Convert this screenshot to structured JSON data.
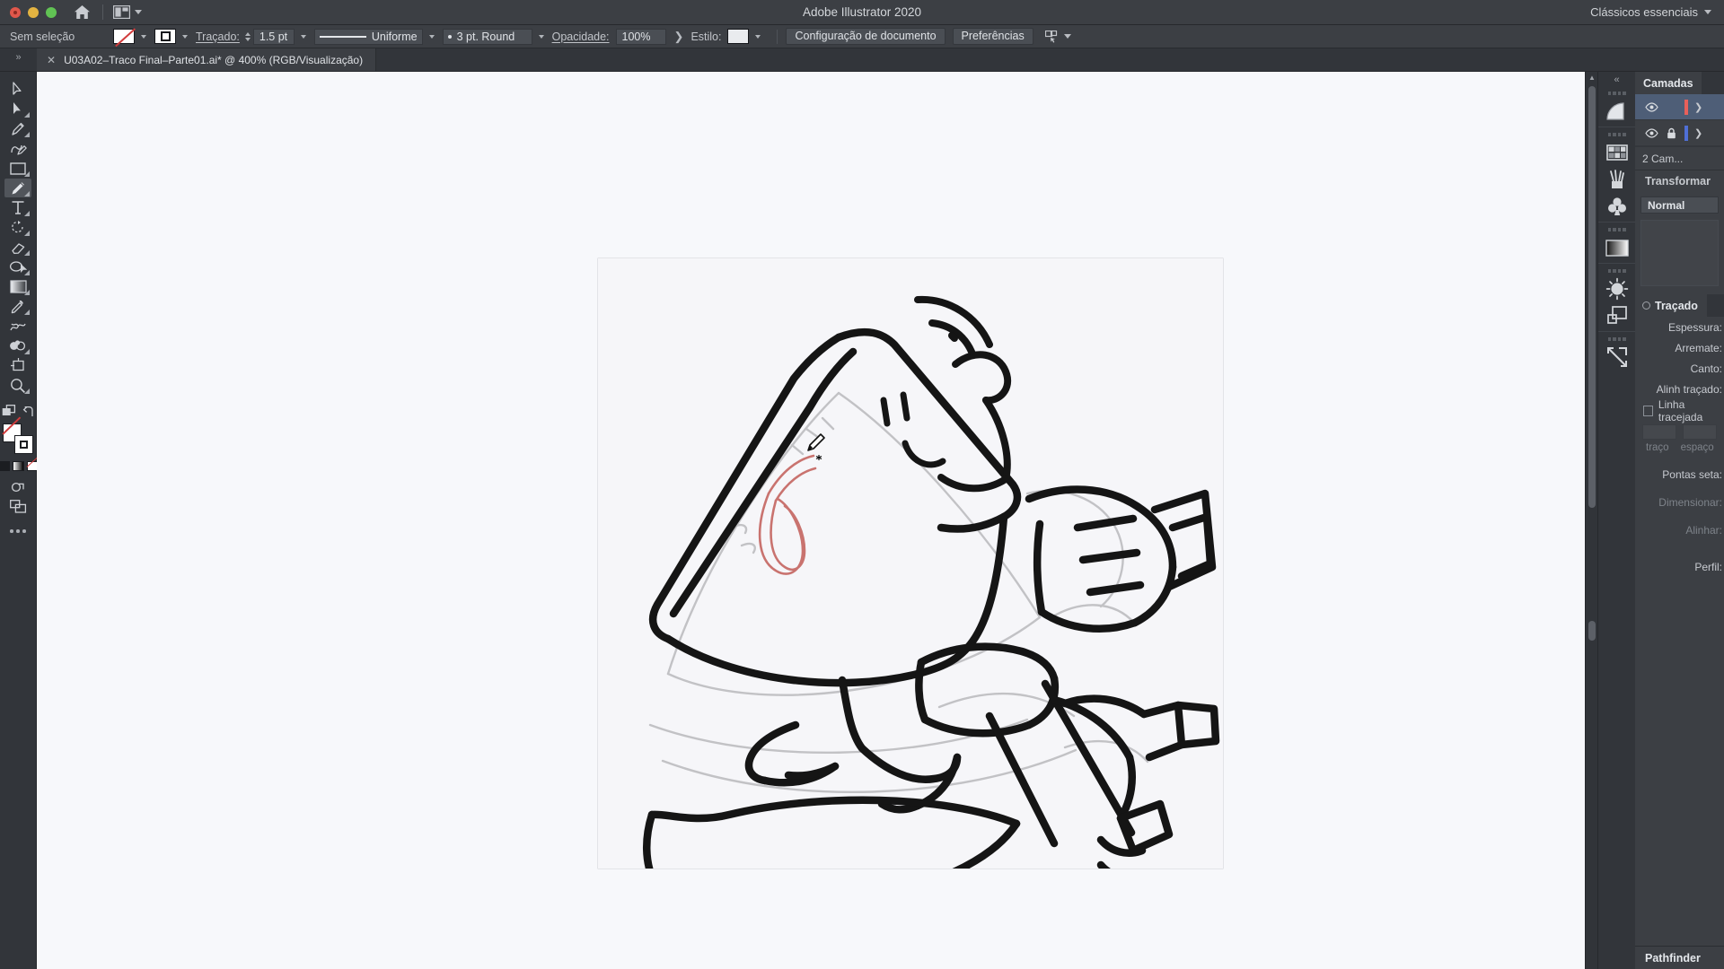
{
  "titlebar": {
    "app_title": "Adobe Illustrator 2020",
    "workspace": "Clássicos essenciais",
    "home_icon": "home-icon",
    "layout_icon": "arrange-documents-icon"
  },
  "controlbar": {
    "selection_status": "Sem seleção",
    "fill_swatch": "none-fill-swatch",
    "stroke_swatch": "stroke-swatch",
    "stroke_label": "Traçado:",
    "stroke_weight": "1.5 pt",
    "stroke_profile": "Uniforme",
    "stroke_cap_corner": "3 pt. Round",
    "opacity_label": "Opacidade:",
    "opacity_value": "100%",
    "style_label": "Estilo:",
    "doc_setup_button": "Configuração de documento",
    "preferences_button": "Preferências",
    "select_similar_icon": "select-similar-icon"
  },
  "tabbar": {
    "collapse_icon": "»",
    "close_icon": "✕",
    "document_tab": "U03A02–Traco Final–Parte01.ai* @ 400% (RGB/Visualização)"
  },
  "toolbar": {
    "tools": [
      {
        "name": "selection-tool",
        "glyph": "selection",
        "corner": false
      },
      {
        "name": "direct-selection-tool",
        "glyph": "direct-selection",
        "corner": true
      },
      {
        "name": "pen-tool",
        "glyph": "pen",
        "corner": true
      },
      {
        "name": "curvature-tool",
        "glyph": "curvature",
        "corner": false
      },
      {
        "name": "rectangle-tool",
        "glyph": "rectangle",
        "corner": true
      },
      {
        "name": "pencil-tool",
        "glyph": "pencil",
        "corner": true,
        "active": true
      },
      {
        "name": "type-tool",
        "glyph": "type",
        "corner": true
      },
      {
        "name": "rotate-tool",
        "glyph": "rotate",
        "corner": true
      },
      {
        "name": "eraser-tool",
        "glyph": "eraser",
        "corner": true
      },
      {
        "name": "free-transform-tool",
        "glyph": "free-transform",
        "corner": true
      },
      {
        "name": "gradient-tool",
        "glyph": "gradient",
        "corner": true
      },
      {
        "name": "eyedropper-tool",
        "glyph": "eyedropper",
        "corner": true
      },
      {
        "name": "blend-tool",
        "glyph": "blend",
        "corner": false
      },
      {
        "name": "symbol-sprayer-tool",
        "glyph": "symbol-sprayer",
        "corner": true
      },
      {
        "name": "artboard-tool",
        "glyph": "artboard",
        "corner": false
      },
      {
        "name": "zoom-tool",
        "glyph": "zoom",
        "corner": true
      }
    ],
    "arrange_icon": "arrange-icon",
    "swap-icon": "swap-fill-stroke-icon",
    "fill_label": "fill-none-swatch",
    "stroke_label": "stroke-swatch",
    "color_modes": [
      "color-swatch",
      "gradient-swatch",
      "none-swatch"
    ],
    "draw_mode_icon": "draw-normal-icon",
    "screen_mode_icon": "screen-mode-icon",
    "more_tools_icon": "more-tools-icon"
  },
  "canvas": {
    "zoom_level": "400%",
    "cursor": "pencil-cursor",
    "artwork_title": "watermelon-character-on-treadmill-sketch",
    "artboard_background": "#f6f6f9",
    "canvas_background": "#f7f8fb",
    "active_path_color": "#c9736f",
    "ink_color": "#161616",
    "sketch_color": "#b9b9bd"
  },
  "rightdock": {
    "collapse_icon": "«",
    "rail_icons": [
      {
        "name": "gradient-panel-icon",
        "glyph": "quarter-circle"
      },
      {
        "name": "swatches-panel-icon",
        "glyph": "grid"
      },
      {
        "name": "brushes-panel-icon",
        "glyph": "brushes"
      },
      {
        "name": "symbols-panel-icon",
        "glyph": "clover"
      },
      {
        "name": "gradient-bar-panel-icon",
        "glyph": "gradient-bar"
      },
      {
        "name": "appearance-panel-icon",
        "glyph": "sun"
      },
      {
        "name": "layers-extra-panel-icon",
        "glyph": "stacked-squares"
      },
      {
        "name": "export-panel-icon",
        "glyph": "export-arrow"
      }
    ],
    "layers_panel": {
      "tab_label": "Camadas",
      "rows": [
        {
          "name": "layer-row-1",
          "visible": true,
          "locked": false,
          "color": "#e8605a",
          "selected": true
        },
        {
          "name": "layer-row-2",
          "visible": true,
          "locked": true,
          "color": "#4f6fd6",
          "selected": false
        }
      ],
      "count_label": "2 Cam..."
    },
    "appearance_panel": {
      "header": "Transformar",
      "blend_mode": "Normal"
    },
    "stroke_panel": {
      "tab_label": "Traçado",
      "rows": [
        {
          "label": "Espessura:",
          "dim": false
        },
        {
          "label": "Arremate:",
          "dim": false
        },
        {
          "label": "Canto:",
          "dim": false
        },
        {
          "label": "Alinh traçado:",
          "dim": false
        }
      ],
      "dashed_label": "Linha tracejada",
      "dash_labels": [
        "traço",
        "espaço"
      ],
      "arrow_label": "Pontas seta:",
      "scale_label": "Dimensionar:",
      "align_label": "Alinhar:",
      "profile_label": "Perfil:"
    },
    "pathfinder_panel": {
      "header": "Pathfinder"
    }
  }
}
